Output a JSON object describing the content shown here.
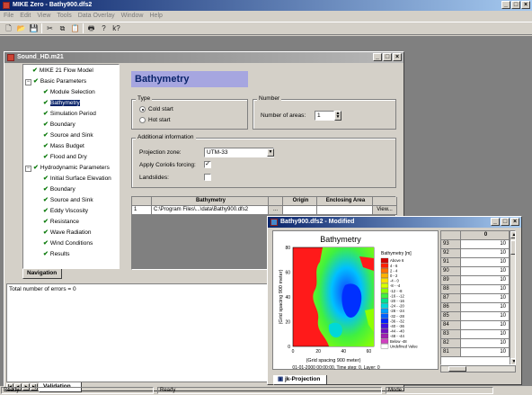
{
  "app": {
    "title": "MIKE Zero - Bathy900.dfs2"
  },
  "menu": [
    "File",
    "Edit",
    "View",
    "Tools",
    "Data Overlay",
    "Window",
    "Help"
  ],
  "toolbar": [
    "new-icon",
    "open-icon",
    "save-icon",
    "cut-icon",
    "copy-icon",
    "paste-icon",
    "print-icon",
    "help-icon",
    "context-help-icon"
  ],
  "toolbar_glyphs": [
    "🗋",
    "📂",
    "💾",
    "✂",
    "⧉",
    "📋",
    "🖶",
    "?",
    "k?"
  ],
  "sound_window": {
    "title": "Sound_HD.m21",
    "tree": [
      {
        "label": "MIKE 21 Flow Model",
        "level": 0
      },
      {
        "label": "Basic Parameters",
        "level": 1,
        "toggle": "−"
      },
      {
        "label": "Module Selection",
        "level": 2
      },
      {
        "label": "Bathymetry",
        "level": 2,
        "selected": true
      },
      {
        "label": "Simulation Period",
        "level": 2
      },
      {
        "label": "Boundary",
        "level": 2
      },
      {
        "label": "Source and Sink",
        "level": 2
      },
      {
        "label": "Mass Budget",
        "level": 2
      },
      {
        "label": "Flood and Dry",
        "level": 2
      },
      {
        "label": "Hydrodynamic Parameters",
        "level": 1,
        "toggle": "−"
      },
      {
        "label": "Initial Surface Elevation",
        "level": 2
      },
      {
        "label": "Boundary",
        "level": 2
      },
      {
        "label": "Source and Sink",
        "level": 2
      },
      {
        "label": "Eddy Viscosity",
        "level": 2
      },
      {
        "label": "Resistance",
        "level": 2
      },
      {
        "label": "Wave Radiation",
        "level": 2
      },
      {
        "label": "Wind Conditions",
        "level": 2
      },
      {
        "label": "Results",
        "level": 2
      }
    ],
    "nav_tab": "Navigation",
    "panel_title": "Bathymetry",
    "type_group": "Type",
    "cold_start": "Cold start",
    "hot_start": "Hot start",
    "number_group": "Number",
    "areas_label": "Number of areas:",
    "areas_value": "1",
    "additional_group": "Additional information",
    "projection_label": "Projection zone:",
    "projection_value": "UTM-33",
    "coriolis_label": "Apply Coriolis forcing:",
    "landslides_label": "Landslides:",
    "table_headers": [
      "",
      "Bathymetry",
      "",
      "Origin",
      "Enclosing Area",
      ""
    ],
    "table_row": {
      "index": "1",
      "path": "C:\\Program Files\\...\\data\\Bathy900.dfs2",
      "button": "...",
      "view": "View..."
    },
    "errors_text": "Total number of errors = 0",
    "validation_tab": "Validation"
  },
  "bathy_window": {
    "title": "Bathy900.dfs2 - Modified",
    "plot_title": "Bathymetry",
    "ylabel": "(Grid spacing 900 meter)",
    "xlabel": "(Grid spacing 900 meter)",
    "footer": "01-01-2000 00:00:00, Time step: 0, Layer: 0",
    "xticks": [
      "0",
      "20",
      "40",
      "60"
    ],
    "yticks": [
      "80",
      "60",
      "40",
      "20",
      "0"
    ],
    "legend_title": "Bathymetry [m]",
    "legend": [
      {
        "label": "Above  6",
        "color": "#d00000"
      },
      {
        "label": "4 -  6",
        "color": "#ff2000"
      },
      {
        "label": "2 -  4",
        "color": "#ff7000"
      },
      {
        "label": "0 -  2",
        "color": "#ffb000"
      },
      {
        "label": "-4 -  0",
        "color": "#ffe000"
      },
      {
        "label": "-8 - -4",
        "color": "#d8ff00"
      },
      {
        "label": "-12 - -8",
        "color": "#90ff00"
      },
      {
        "label": "-16 - -12",
        "color": "#40f040"
      },
      {
        "label": "-20 - -16",
        "color": "#00e090"
      },
      {
        "label": "-24 - -20",
        "color": "#00d8d8"
      },
      {
        "label": "-28 - -24",
        "color": "#00a0ff"
      },
      {
        "label": "-32 - -28",
        "color": "#0060ff"
      },
      {
        "label": "-36 - -32",
        "color": "#0020ff"
      },
      {
        "label": "-40 - -36",
        "color": "#4010e0"
      },
      {
        "label": "-44 - -40",
        "color": "#7010c0"
      },
      {
        "label": "-48 - -44",
        "color": "#a020b0"
      },
      {
        "label": "Below -48",
        "color": "#d040c0"
      },
      {
        "label": "Undefined Value",
        "color": "#ffffff"
      }
    ],
    "grid_header": "0",
    "grid_rows": [
      {
        "idx": "93",
        "val": "10"
      },
      {
        "idx": "92",
        "val": "10"
      },
      {
        "idx": "91",
        "val": "10"
      },
      {
        "idx": "90",
        "val": "10"
      },
      {
        "idx": "89",
        "val": "10"
      },
      {
        "idx": "88",
        "val": "10"
      },
      {
        "idx": "87",
        "val": "10"
      },
      {
        "idx": "86",
        "val": "10"
      },
      {
        "idx": "85",
        "val": "10"
      },
      {
        "idx": "84",
        "val": "10"
      },
      {
        "idx": "83",
        "val": "10"
      },
      {
        "idx": "82",
        "val": "10"
      },
      {
        "idx": "81",
        "val": "10"
      }
    ],
    "tab": "jk-Projection"
  },
  "status": [
    "Ready",
    "Ready",
    "Mode"
  ]
}
